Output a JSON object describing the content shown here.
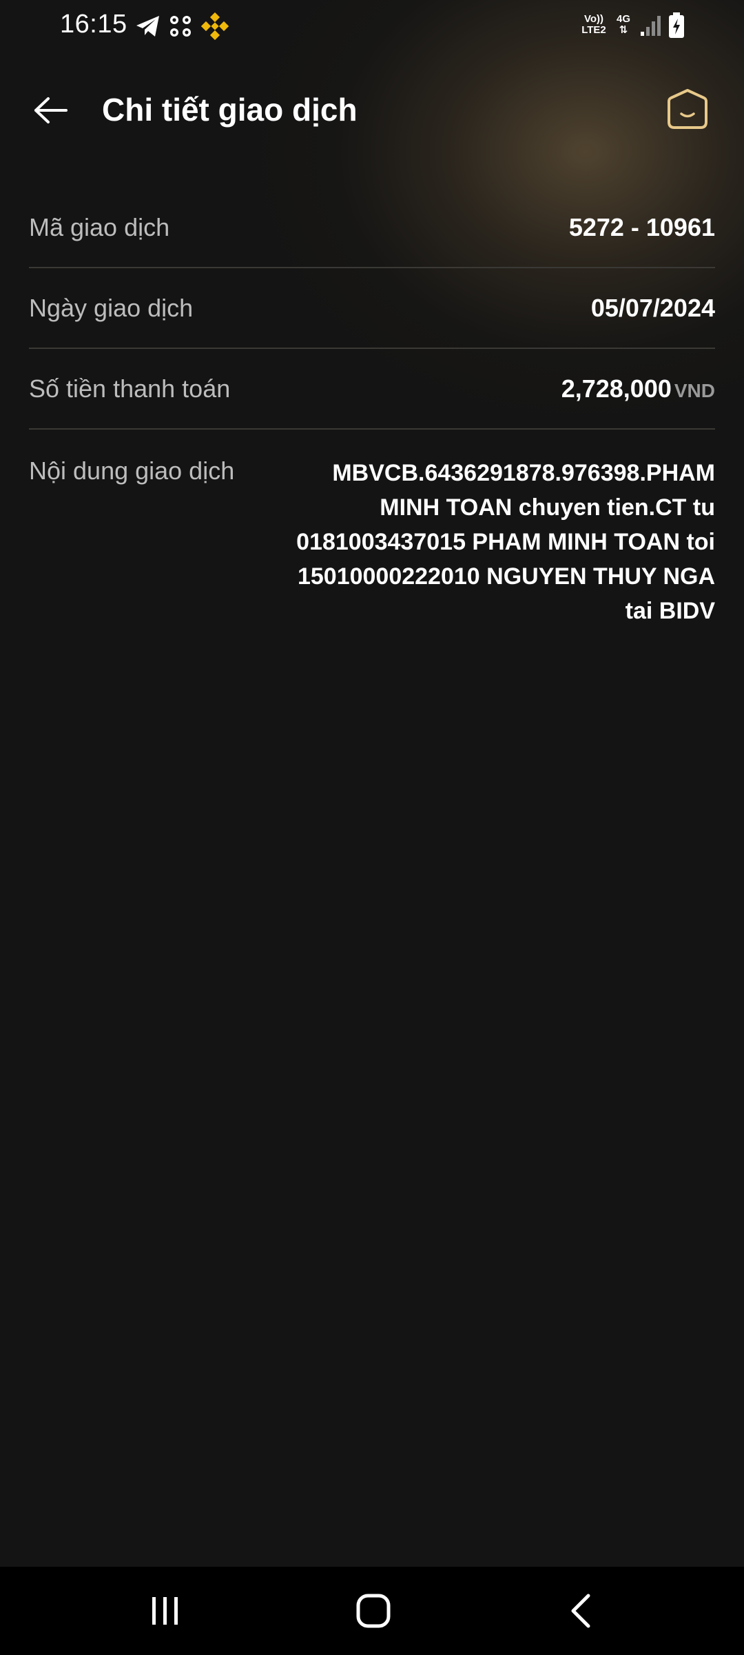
{
  "status_bar": {
    "time": "16:15",
    "network_top": "Vo))",
    "network_bottom": "LTE2",
    "data_type": "4G",
    "icons": [
      "telegram-icon",
      "momo-icon",
      "binance-icon",
      "signal-icon",
      "battery-charging-icon"
    ]
  },
  "header": {
    "title": "Chi tiết giao dịch",
    "back_icon": "arrow-left-icon",
    "home_icon": "home-icon"
  },
  "details": [
    {
      "label": "Mã giao dịch",
      "value": "5272 - 10961"
    },
    {
      "label": "Ngày giao dịch",
      "value": "05/07/2024"
    },
    {
      "label": "Số tiền thanh toán",
      "value": "2,728,000",
      "currency": "VND"
    },
    {
      "label": "Nội dung giao dịch",
      "value": "MBVCB.6436291878.976398.PHAM MINH TOAN chuyen tien.CT tu 0181003437015 PHAM MINH TOAN toi 15010000222010 NGUYEN THUY NGA tai BIDV"
    }
  ],
  "nav_bar": {
    "buttons": [
      "recent-apps-icon",
      "home-button-icon",
      "back-icon"
    ]
  },
  "colors": {
    "background": "#141414",
    "accent_gold": "#e8c98a",
    "label_grey": "#bdbdbd",
    "divider": "#3b3935"
  }
}
